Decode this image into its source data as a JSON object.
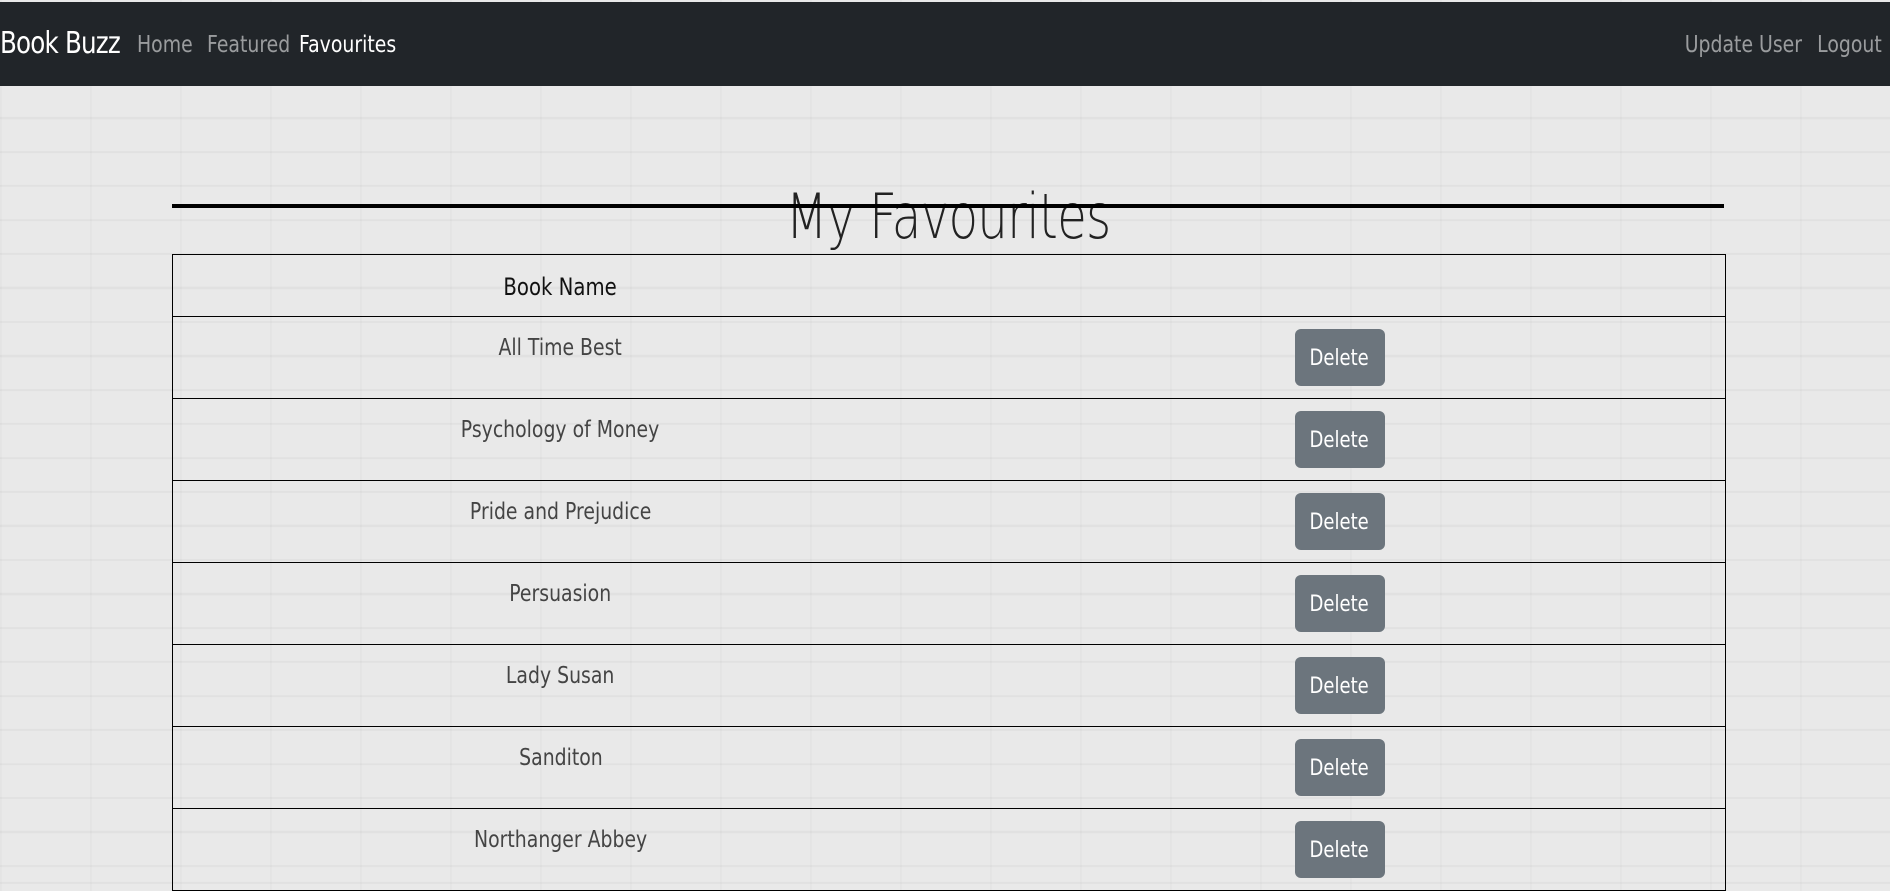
{
  "navbar": {
    "brand": "Book Buzz",
    "links": [
      {
        "label": "Home",
        "active": false
      },
      {
        "label": "Featured",
        "active": false
      },
      {
        "label": "Favourites",
        "active": true
      }
    ],
    "right_links": [
      {
        "label": "Update User"
      },
      {
        "label": "Logout"
      }
    ]
  },
  "page": {
    "title": "My Favourites"
  },
  "table": {
    "headers": [
      "Book Name",
      ""
    ],
    "rows": [
      {
        "book_name": "All Time Best",
        "action": "Delete"
      },
      {
        "book_name": "Psychology of Money",
        "action": "Delete"
      },
      {
        "book_name": "Pride and Prejudice",
        "action": "Delete"
      },
      {
        "book_name": "Persuasion",
        "action": "Delete"
      },
      {
        "book_name": "Lady Susan",
        "action": "Delete"
      },
      {
        "book_name": "Sanditon",
        "action": "Delete"
      },
      {
        "book_name": "Northanger Abbey",
        "action": "Delete"
      }
    ]
  },
  "colors": {
    "navbar_bg": "#212529",
    "nav_link_inactive": "rgba(255,255,255,0.55)",
    "nav_link_active": "#ffffff",
    "delete_button_bg": "#6c757d",
    "page_bg": "#e9e9e9"
  }
}
